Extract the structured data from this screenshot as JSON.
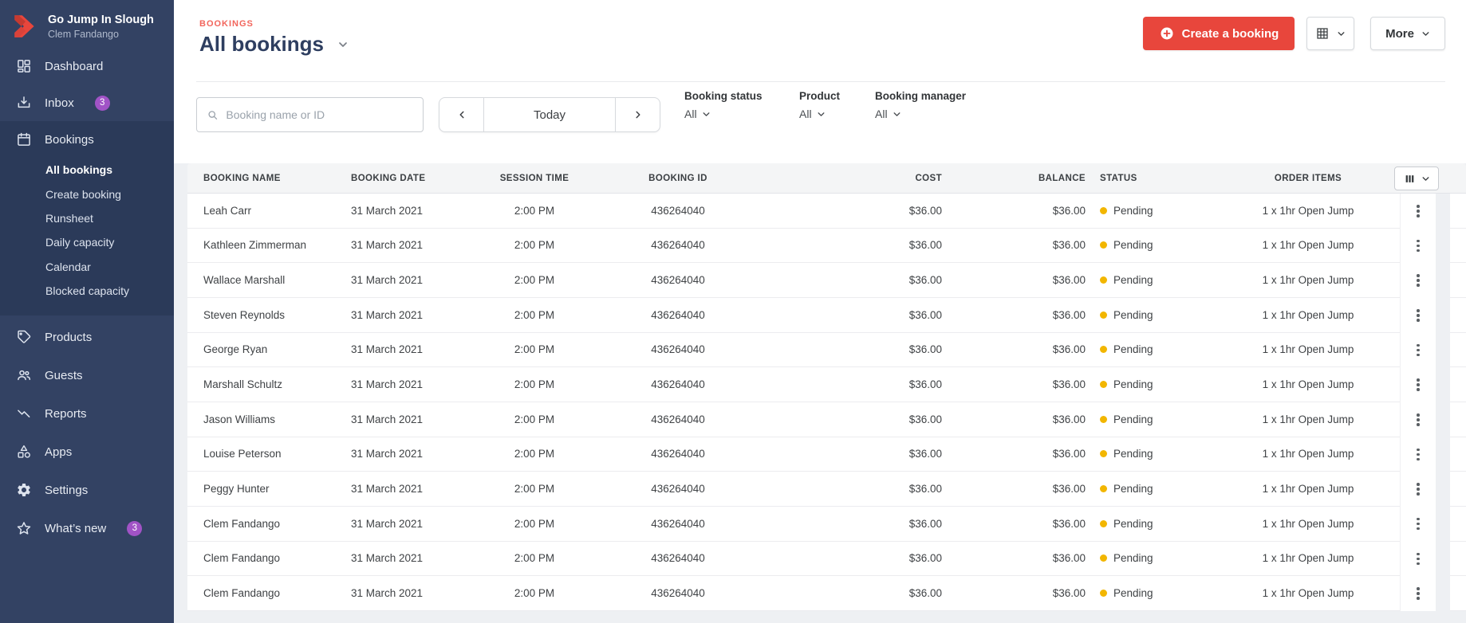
{
  "colors": {
    "accent_red": "#E8463C",
    "eyebrow_red": "#F2655C",
    "sidebar": "#334263",
    "sidebar_active": "#2B3A59",
    "badge_purple": "#A153C6",
    "status_pending_dot": "#F2B600",
    "title_navy": "#2E3E60"
  },
  "sidebar": {
    "brand": {
      "name": "Go Jump In Slough",
      "subtitle": "Clem Fandango"
    },
    "dashboard": "Dashboard",
    "inbox": "Inbox",
    "inbox_badge": "3",
    "bookings": "Bookings",
    "bookings_sub": [
      "All bookings",
      "Create booking",
      "Runsheet",
      "Daily capacity",
      "Calendar",
      "Blocked capacity"
    ],
    "products": "Products",
    "guests": "Guests",
    "reports": "Reports",
    "apps": "Apps",
    "settings": "Settings",
    "whats_new": "What’s new",
    "whats_new_badge": "3"
  },
  "header": {
    "eyebrow": "BOOKINGS",
    "title": "All bookings",
    "create_button": "Create a booking",
    "more_button": "More"
  },
  "filters": {
    "search_placeholder": "Booking name or ID",
    "date_today": "Today",
    "groups": [
      {
        "label": "Booking status",
        "value": "All"
      },
      {
        "label": "Product",
        "value": "All"
      },
      {
        "label": "Booking manager",
        "value": "All"
      }
    ]
  },
  "table": {
    "columns": {
      "name": "Booking name",
      "date": "Booking date",
      "session": "Session time",
      "id": "Booking ID",
      "cost": "Cost",
      "balance": "Balance",
      "status": "Status",
      "items": "Order items"
    },
    "rows": [
      {
        "name": "Leah Carr",
        "date": "31 March 2021",
        "session": "2:00 PM",
        "id": "436264040",
        "cost": "$36.00",
        "balance": "$36.00",
        "status": "Pending",
        "items": "1 x 1hr Open Jump"
      },
      {
        "name": "Kathleen Zimmerman",
        "date": "31 March 2021",
        "session": "2:00 PM",
        "id": "436264040",
        "cost": "$36.00",
        "balance": "$36.00",
        "status": "Pending",
        "items": "1 x 1hr Open Jump"
      },
      {
        "name": "Wallace Marshall",
        "date": "31 March 2021",
        "session": "2:00 PM",
        "id": "436264040",
        "cost": "$36.00",
        "balance": "$36.00",
        "status": "Pending",
        "items": "1 x 1hr Open Jump"
      },
      {
        "name": "Steven Reynolds",
        "date": "31 March 2021",
        "session": "2:00 PM",
        "id": "436264040",
        "cost": "$36.00",
        "balance": "$36.00",
        "status": "Pending",
        "items": "1 x 1hr Open Jump"
      },
      {
        "name": "George Ryan",
        "date": "31 March 2021",
        "session": "2:00 PM",
        "id": "436264040",
        "cost": "$36.00",
        "balance": "$36.00",
        "status": "Pending",
        "items": "1 x 1hr Open Jump"
      },
      {
        "name": "Marshall Schultz",
        "date": "31 March 2021",
        "session": "2:00 PM",
        "id": "436264040",
        "cost": "$36.00",
        "balance": "$36.00",
        "status": "Pending",
        "items": "1 x 1hr Open Jump"
      },
      {
        "name": "Jason Williams",
        "date": "31 March 2021",
        "session": "2:00 PM",
        "id": "436264040",
        "cost": "$36.00",
        "balance": "$36.00",
        "status": "Pending",
        "items": "1 x 1hr Open Jump"
      },
      {
        "name": "Louise Peterson",
        "date": "31 March 2021",
        "session": "2:00 PM",
        "id": "436264040",
        "cost": "$36.00",
        "balance": "$36.00",
        "status": "Pending",
        "items": "1 x 1hr Open Jump"
      },
      {
        "name": "Peggy Hunter",
        "date": "31 March 2021",
        "session": "2:00 PM",
        "id": "436264040",
        "cost": "$36.00",
        "balance": "$36.00",
        "status": "Pending",
        "items": "1 x 1hr Open Jump"
      },
      {
        "name": "Clem Fandango",
        "date": "31 March 2021",
        "session": "2:00 PM",
        "id": "436264040",
        "cost": "$36.00",
        "balance": "$36.00",
        "status": "Pending",
        "items": "1 x 1hr Open Jump"
      },
      {
        "name": "Clem Fandango",
        "date": "31 March 2021",
        "session": "2:00 PM",
        "id": "436264040",
        "cost": "$36.00",
        "balance": "$36.00",
        "status": "Pending",
        "items": "1 x 1hr Open Jump"
      },
      {
        "name": "Clem Fandango",
        "date": "31 March 2021",
        "session": "2:00 PM",
        "id": "436264040",
        "cost": "$36.00",
        "balance": "$36.00",
        "status": "Pending",
        "items": "1 x 1hr Open Jump"
      }
    ]
  }
}
